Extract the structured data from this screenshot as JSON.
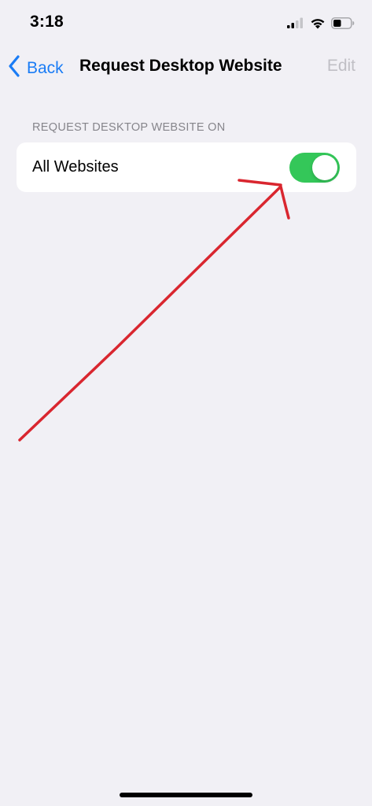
{
  "status_bar": {
    "time": "3:18",
    "signal_icon": "cellular-signal-icon",
    "wifi_icon": "wifi-icon",
    "battery_icon": "battery-icon",
    "battery_level": 0.45
  },
  "nav": {
    "back_label": "Back",
    "back_icon": "chevron-left-icon",
    "title": "Request Desktop Website",
    "edit_label": "Edit"
  },
  "section": {
    "header": "REQUEST DESKTOP WEBSITE ON",
    "rows": [
      {
        "label": "All Websites",
        "toggle_on": true
      }
    ]
  },
  "colors": {
    "accent": "#1a7cf5",
    "toggle_on": "#34c759",
    "background": "#f1f0f5",
    "annotation": "#d9262f",
    "disabled_text": "#c0bfc5"
  },
  "annotation": {
    "type": "hand-drawn-arrow",
    "icon": "red-arrow-icon"
  }
}
